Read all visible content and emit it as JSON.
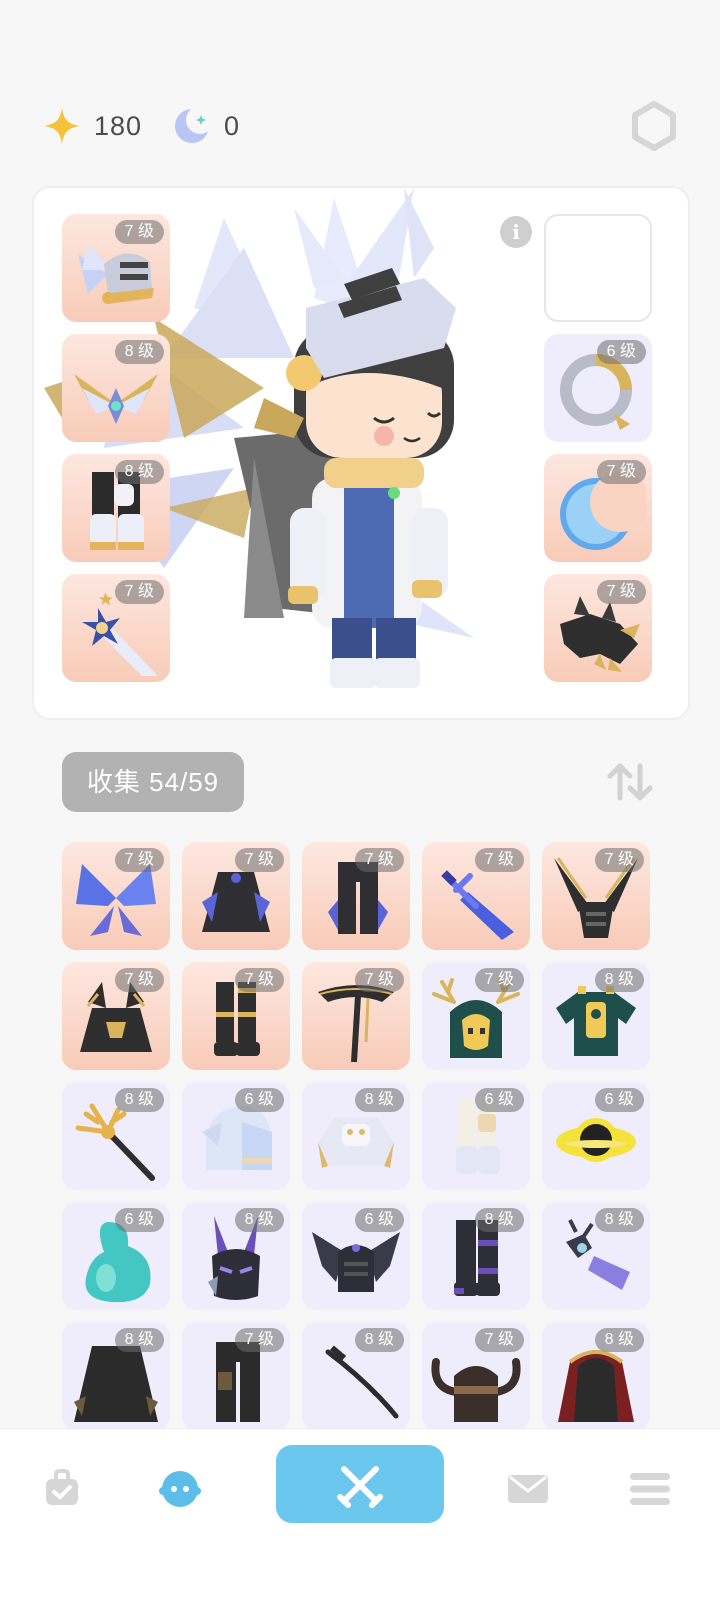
{
  "currency": {
    "stars": {
      "icon": "star-icon",
      "value": "180"
    },
    "moons": {
      "icon": "moon-icon",
      "value": "0"
    }
  },
  "equipment": {
    "left_slots": [
      {
        "level": "7 级",
        "item": "winged-helmet"
      },
      {
        "level": "8 级",
        "item": "golden-wings-emblem"
      },
      {
        "level": "8 级",
        "item": "dark-boots"
      },
      {
        "level": "7 级",
        "item": "star-lance"
      }
    ],
    "right_slots": [
      {
        "level": "",
        "item": "empty"
      },
      {
        "level": "6 级",
        "item": "serpent-ring"
      },
      {
        "level": "7 级",
        "item": "crescent-moon"
      },
      {
        "level": "7 级",
        "item": "dragon-head"
      }
    ]
  },
  "collection": {
    "label": "收集 54/59",
    "items": [
      {
        "level": "7 级",
        "item": "blue-butterfly"
      },
      {
        "level": "7 级",
        "item": "dark-cloak"
      },
      {
        "level": "7 级",
        "item": "dark-pants"
      },
      {
        "level": "7 级",
        "item": "blue-sword"
      },
      {
        "level": "7 级",
        "item": "horned-helm"
      },
      {
        "level": "7 级",
        "item": "dark-armor"
      },
      {
        "level": "7 级",
        "item": "dark-boots"
      },
      {
        "level": "7 级",
        "item": "scythe"
      },
      {
        "level": "7 级",
        "item": "antler-hood"
      },
      {
        "level": "8 级",
        "item": "green-robe"
      },
      {
        "level": "8 级",
        "item": "golden-staff"
      },
      {
        "level": "6 级",
        "item": "white-helmet"
      },
      {
        "level": "8 级",
        "item": "white-armor"
      },
      {
        "level": "6 级",
        "item": "white-boots"
      },
      {
        "level": "6 级",
        "item": "eclipse-orb"
      },
      {
        "level": "6 级",
        "item": "teal-bottle"
      },
      {
        "level": "8 级",
        "item": "purple-horned-mask"
      },
      {
        "level": "6 级",
        "item": "bat-wing-helm"
      },
      {
        "level": "8 级",
        "item": "dark-greaves"
      },
      {
        "level": "8 级",
        "item": "purple-crystal-staff"
      },
      {
        "level": "8 级",
        "item": "dark-cape"
      },
      {
        "level": "7 级",
        "item": "dark-trousers"
      },
      {
        "level": "8 级",
        "item": "katana"
      },
      {
        "level": "7 级",
        "item": "horned-helmet"
      },
      {
        "level": "8 级",
        "item": "red-cloak"
      }
    ]
  },
  "nav": {
    "items": [
      {
        "icon": "bag-icon"
      },
      {
        "icon": "avatar-icon"
      },
      {
        "icon": "crossed-swords-icon"
      },
      {
        "icon": "mail-icon"
      },
      {
        "icon": "menu-icon"
      }
    ]
  },
  "colors": {
    "accent": "#6cc7ef",
    "peach_slot": "#f8cbb8",
    "lavender_slot": "#efedfb",
    "gold": "#d9ab56"
  }
}
